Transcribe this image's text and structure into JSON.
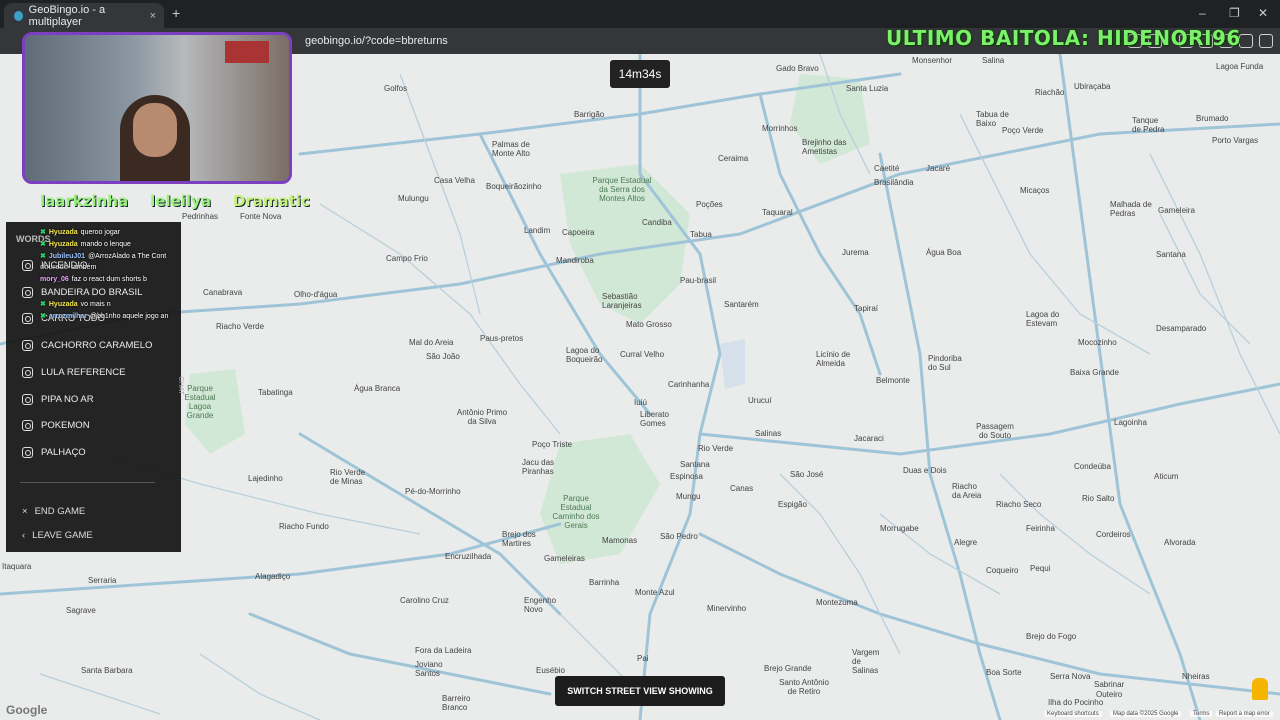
{
  "browser": {
    "tab_title": "GeoBingo.io - a multiplayer",
    "tab_close": "×",
    "new_tab": "+",
    "url": "geobingo.io/?code=bbreturns",
    "window_controls": [
      "–",
      "❐",
      "✕"
    ]
  },
  "stream_overlay": {
    "title": "ULTIMO BAITOLA: HIDENORI96",
    "names": [
      "laarkzinha",
      "leleilya",
      "Dramatic"
    ]
  },
  "game": {
    "timer": "14m34s",
    "words_header": "WORDS",
    "words": [
      "INCENDIO",
      "BANDEIRA DO BRASIL",
      "CARRO TODO",
      "CACHORRO CARAMELO",
      "LULA REFERENCE",
      "PIPA NO AR",
      "POKEMON",
      "PALHAÇO"
    ],
    "actions": {
      "end_game": "END GAME",
      "leave_game": "LEAVE GAME",
      "end_icon": "×",
      "leave_icon": "‹"
    },
    "side_tab": "CHAT",
    "switch_street_view": "SWITCH STREET VIEW SHOWING"
  },
  "chat": [
    {
      "user": "Hyuzada",
      "text": "queroo jogar",
      "style": "yellow"
    },
    {
      "user": "Hyuzada",
      "text": "mando o lenque",
      "style": "yellow"
    },
    {
      "user": "JubileuJ01",
      "text": "@ArrozAlado a The Cont",
      "style": "blue"
    },
    {
      "user": "dourado",
      "text": "também",
      "style": "white"
    },
    {
      "user": "mory_06",
      "text": "faz o react dum shorts b",
      "style": "pink"
    },
    {
      "user": "Hyuzada",
      "text": "vo mais n",
      "style": "yellow"
    },
    {
      "user": "arrozmilhar",
      "text": "@bb1nho aquele jogo an",
      "style": "blue"
    }
  ],
  "map": {
    "places": [
      {
        "name": "Golfos"
      },
      {
        "name": "Barrigão"
      },
      {
        "name": "Gado Bravo"
      },
      {
        "name": "Monsenhor"
      },
      {
        "name": "Salina"
      },
      {
        "name": "Lagoa Funda"
      },
      {
        "name": "Ubiraçaba"
      },
      {
        "name": "Riachão"
      },
      {
        "name": "Palmas de Monte Alto"
      },
      {
        "name": "Casa Velha"
      },
      {
        "name": "Boqueirãozinho"
      },
      {
        "name": "Mulungu"
      },
      {
        "name": "Pedrinhas"
      },
      {
        "name": "Fonte Nova"
      },
      {
        "name": "Ceraima"
      },
      {
        "name": "Morrinhos"
      },
      {
        "name": "Brejinho das Ametistas"
      },
      {
        "name": "Santa Luzia"
      },
      {
        "name": "Tabua de Baixo"
      },
      {
        "name": "Tanque de Pedra"
      },
      {
        "name": "Brumado"
      },
      {
        "name": "Poço Verde"
      },
      {
        "name": "Porto Vargas"
      },
      {
        "name": "Candiba"
      },
      {
        "name": "Poções"
      },
      {
        "name": "Caetité"
      },
      {
        "name": "Brasilândia"
      },
      {
        "name": "Jacaré"
      },
      {
        "name": "Malhada de Pedras"
      },
      {
        "name": "Gameleira"
      },
      {
        "name": "Micaços"
      },
      {
        "name": "Landim"
      },
      {
        "name": "Capoeira"
      },
      {
        "name": "Tabua"
      },
      {
        "name": "Taquaral"
      },
      {
        "name": "Jurema"
      },
      {
        "name": "Água Boa"
      },
      {
        "name": "Campo Frio"
      },
      {
        "name": "Mandiroba"
      },
      {
        "name": "Pau-brasil"
      },
      {
        "name": "Canabrava"
      },
      {
        "name": "Olho-d'água"
      },
      {
        "name": "Sebastião Laranjeiras"
      },
      {
        "name": "Paus-pretos"
      },
      {
        "name": "Santarém"
      },
      {
        "name": "Tapiraí"
      },
      {
        "name": "Lagoa do Estevam"
      },
      {
        "name": "Santana"
      },
      {
        "name": "Desamparado"
      },
      {
        "name": "Riacho Verde"
      },
      {
        "name": "Mato Grosso"
      },
      {
        "name": "Mocozinho"
      },
      {
        "name": "São João"
      },
      {
        "name": "Mal do Areia"
      },
      {
        "name": "Lagoa do Boqueirão"
      },
      {
        "name": "Curral Velho"
      },
      {
        "name": "Licínio de Almeida"
      },
      {
        "name": "Pindoriba do Sul"
      },
      {
        "name": "Baixa Grande"
      },
      {
        "name": "Carinhanha"
      },
      {
        "name": "Belmonte"
      },
      {
        "name": "Tabatinga"
      },
      {
        "name": "Água Branca"
      },
      {
        "name": "Antônio Primo da Silva"
      },
      {
        "name": "Liberato Gomes"
      },
      {
        "name": "Urucuí"
      },
      {
        "name": "Iuiú"
      },
      {
        "name": "Salinas"
      },
      {
        "name": "Jacaraci"
      },
      {
        "name": "Passagem do Souto"
      },
      {
        "name": "Lagoinha"
      },
      {
        "name": "Poço Triste"
      },
      {
        "name": "Rio Verde"
      },
      {
        "name": "Santana"
      },
      {
        "name": "Espinosa"
      },
      {
        "name": "São José"
      },
      {
        "name": "Duas e Dois"
      },
      {
        "name": "Condeúba"
      },
      {
        "name": "Aticum"
      },
      {
        "name": "Lajedinho"
      },
      {
        "name": "Rio Verde de Minas"
      },
      {
        "name": "Pé-do-Morrinho"
      },
      {
        "name": "Jacu das Piranhas"
      },
      {
        "name": "Canas"
      },
      {
        "name": "Espigão"
      },
      {
        "name": "Riacho da Areia"
      },
      {
        "name": "Riacho Seco"
      },
      {
        "name": "Rio Salto"
      },
      {
        "name": "Mungu"
      },
      {
        "name": "Riacho Fundo"
      },
      {
        "name": "Encruzilhada"
      },
      {
        "name": "Brejo dos Martires"
      },
      {
        "name": "Gameleiras"
      },
      {
        "name": "Mamonas"
      },
      {
        "name": "São Pedro"
      },
      {
        "name": "Morrugabe"
      },
      {
        "name": "Alegre"
      },
      {
        "name": "Feirinha"
      },
      {
        "name": "Cordeiros"
      },
      {
        "name": "Alvorada"
      },
      {
        "name": "Coqueiro"
      },
      {
        "name": "Pequi"
      },
      {
        "name": "Itaquara"
      },
      {
        "name": "Serraria"
      },
      {
        "name": "Alagadiço"
      },
      {
        "name": "Sagrave"
      },
      {
        "name": "Carolino Cruz"
      },
      {
        "name": "Engenho Novo"
      },
      {
        "name": "Barrinha"
      },
      {
        "name": "Monte Azul"
      },
      {
        "name": "Minervinho"
      },
      {
        "name": "Montezuma"
      },
      {
        "name": "Brejo do Fogo"
      },
      {
        "name": "Santa Barbara"
      },
      {
        "name": "Fora da Ladeira"
      },
      {
        "name": "Joviano Santos"
      },
      {
        "name": "Pai"
      },
      {
        "name": "Vargem de Salinas"
      },
      {
        "name": "Brejo Grande"
      },
      {
        "name": "Boa Sorte"
      },
      {
        "name": "Barreiro Branco"
      },
      {
        "name": "Eusébio"
      },
      {
        "name": "Santo Antônio de Retiro"
      },
      {
        "name": "Serra Nova"
      },
      {
        "name": "Sabrinar"
      },
      {
        "name": "Outeiro"
      },
      {
        "name": "Nheiras"
      },
      {
        "name": "Ilha do Pocinho"
      }
    ],
    "parks": [
      {
        "name": "Parque Estadual da Serra dos Montes Altos"
      },
      {
        "name": "Parque Estadual Caminho dos Gerais"
      },
      {
        "name": "Parque Estadual Lagoa Grande"
      }
    ],
    "google_logo": "Google",
    "attribution": [
      "Keyboard shortcuts",
      "Map data ©2025 Google",
      "Terms",
      "Report a map error"
    ]
  }
}
